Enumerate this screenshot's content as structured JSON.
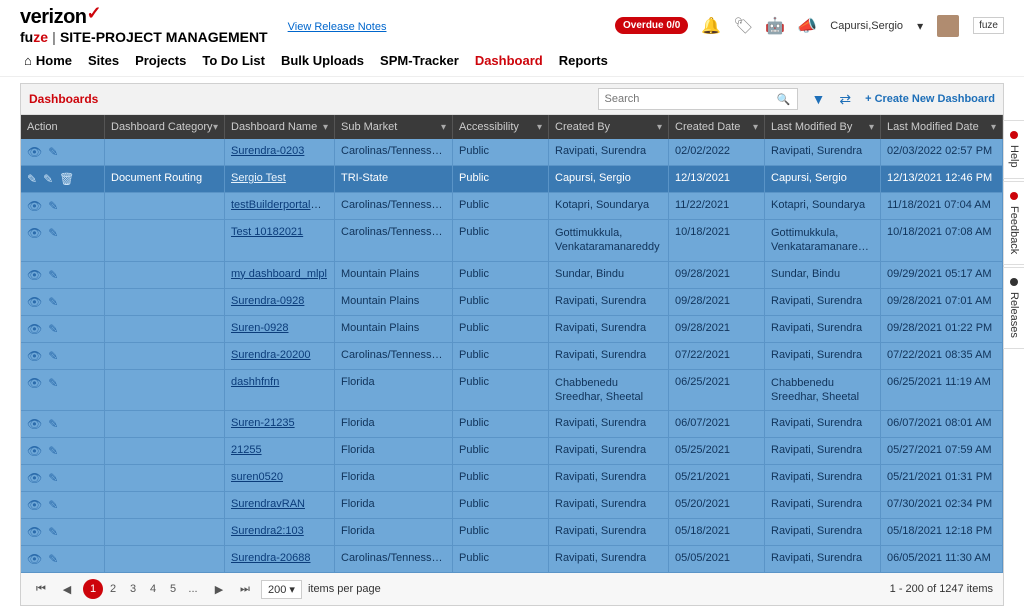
{
  "header": {
    "brand_top": "verizon",
    "brand_bottom_prefix": "fu",
    "brand_bottom_red": "ze",
    "brand_suffix": "SITE-PROJECT MANAGEMENT",
    "release_notes": "View Release Notes",
    "overdue": "Overdue 0/0",
    "user": "Capursi,Sergio",
    "fuze_tag": "fuze"
  },
  "nav": {
    "home": "Home",
    "sites": "Sites",
    "projects": "Projects",
    "todo": "To Do List",
    "bulk": "Bulk Uploads",
    "tracker": "SPM-Tracker",
    "dashboard": "Dashboard",
    "reports": "Reports"
  },
  "panel": {
    "title": "Dashboards",
    "search_placeholder": "Search",
    "create": "+ Create New Dashboard"
  },
  "columns": {
    "action": "Action",
    "category": "Dashboard Category",
    "name": "Dashboard Name",
    "sub": "Sub Market",
    "acc": "Accessibility",
    "cby": "Created By",
    "cdate": "Created Date",
    "mby": "Last Modified By",
    "mdate": "Last Modified Date"
  },
  "rows": [
    {
      "cat": "",
      "name": "Surendra-0203",
      "sub": "Carolinas/Tennessee,C...",
      "acc": "Public",
      "cby": "Ravipati, Surendra",
      "cdate": "02/02/2022",
      "mby": "Ravipati, Surendra",
      "mdate": "02/03/2022 02:57 PM"
    },
    {
      "cat": "Document Routing",
      "name": "Sergio Test",
      "sub": "TRI-State",
      "acc": "Public",
      "cby": "Capursi, Sergio",
      "cdate": "12/13/2021",
      "mby": "Capursi, Sergio",
      "mdate": "12/13/2021 12:46 PM",
      "sel": true,
      "del": true
    },
    {
      "cat": "",
      "name": "testBuilderportalDashbo...",
      "sub": "Carolinas/Tennessee,C...",
      "acc": "Public",
      "cby": "Kotapri, Soundarya",
      "cdate": "11/22/2021",
      "mby": "Kotapri, Soundarya",
      "mdate": "11/18/2021 07:04 AM"
    },
    {
      "cat": "",
      "name": "Test 10182021",
      "sub": "Carolinas/Tennessee,C...",
      "acc": "Public",
      "cby": "Gottimukkula, Venkataramanareddy",
      "cdate": "10/18/2021",
      "mby": "Gottimukkula, Venkataramanareddy",
      "mdate": "10/18/2021 07:08 AM",
      "tall": true
    },
    {
      "cat": "",
      "name": "my dashboard_mlpl",
      "sub": "Mountain Plains",
      "acc": "Public",
      "cby": "Sundar, Bindu",
      "cdate": "09/28/2021",
      "mby": "Sundar, Bindu",
      "mdate": "09/29/2021 05:17 AM"
    },
    {
      "cat": "",
      "name": "Surendra-0928",
      "sub": "Mountain Plains",
      "acc": "Public",
      "cby": "Ravipati, Surendra",
      "cdate": "09/28/2021",
      "mby": "Ravipati, Surendra",
      "mdate": "09/28/2021 07:01 AM"
    },
    {
      "cat": "",
      "name": "Suren-0928",
      "sub": "Mountain Plains",
      "acc": "Public",
      "cby": "Ravipati, Surendra",
      "cdate": "09/28/2021",
      "mby": "Ravipati, Surendra",
      "mdate": "09/28/2021 01:22 PM"
    },
    {
      "cat": "",
      "name": "Surendra-20200",
      "sub": "Carolinas/Tennessee,C...",
      "acc": "Public",
      "cby": "Ravipati, Surendra",
      "cdate": "07/22/2021",
      "mby": "Ravipati, Surendra",
      "mdate": "07/22/2021 08:35 AM"
    },
    {
      "cat": "",
      "name": "dashhfnfn",
      "sub": "Florida",
      "acc": "Public",
      "cby": "Chabbenedu Sreedhar, Sheetal",
      "cdate": "06/25/2021",
      "mby": "Chabbenedu Sreedhar, Sheetal",
      "mdate": "06/25/2021 11:19 AM",
      "tall": true
    },
    {
      "cat": "",
      "name": "Suren-21235",
      "sub": "Florida",
      "acc": "Public",
      "cby": "Ravipati, Surendra",
      "cdate": "06/07/2021",
      "mby": "Ravipati, Surendra",
      "mdate": "06/07/2021 08:01 AM"
    },
    {
      "cat": "",
      "name": "21255",
      "sub": "Florida",
      "acc": "Public",
      "cby": "Ravipati, Surendra",
      "cdate": "05/25/2021",
      "mby": "Ravipati, Surendra",
      "mdate": "05/27/2021 07:59 AM"
    },
    {
      "cat": "",
      "name": "suren0520",
      "sub": "Florida",
      "acc": "Public",
      "cby": "Ravipati, Surendra",
      "cdate": "05/21/2021",
      "mby": "Ravipati, Surendra",
      "mdate": "05/21/2021 01:31 PM"
    },
    {
      "cat": "",
      "name": "SurendravRAN",
      "sub": "Florida",
      "acc": "Public",
      "cby": "Ravipati, Surendra",
      "cdate": "05/20/2021",
      "mby": "Ravipati, Surendra",
      "mdate": "07/30/2021 02:34 PM"
    },
    {
      "cat": "",
      "name": "Surendra2:103",
      "sub": "Florida",
      "acc": "Public",
      "cby": "Ravipati, Surendra",
      "cdate": "05/18/2021",
      "mby": "Ravipati, Surendra",
      "mdate": "05/18/2021 12:18 PM"
    },
    {
      "cat": "",
      "name": "Surendra-20688",
      "sub": "Carolinas/Tennessee,C...",
      "acc": "Public",
      "cby": "Ravipati, Surendra",
      "cdate": "05/05/2021",
      "mby": "Ravipati, Surendra",
      "mdate": "06/05/2021 11:30 AM"
    }
  ],
  "pager": {
    "pages": [
      "1",
      "2",
      "3",
      "4",
      "5",
      "..."
    ],
    "size": "200",
    "size_label": "items per page",
    "info": "1 - 200 of 1247 items"
  },
  "sidetabs": {
    "help": "Help",
    "feedback": "Feedback",
    "releases": "Releases"
  }
}
